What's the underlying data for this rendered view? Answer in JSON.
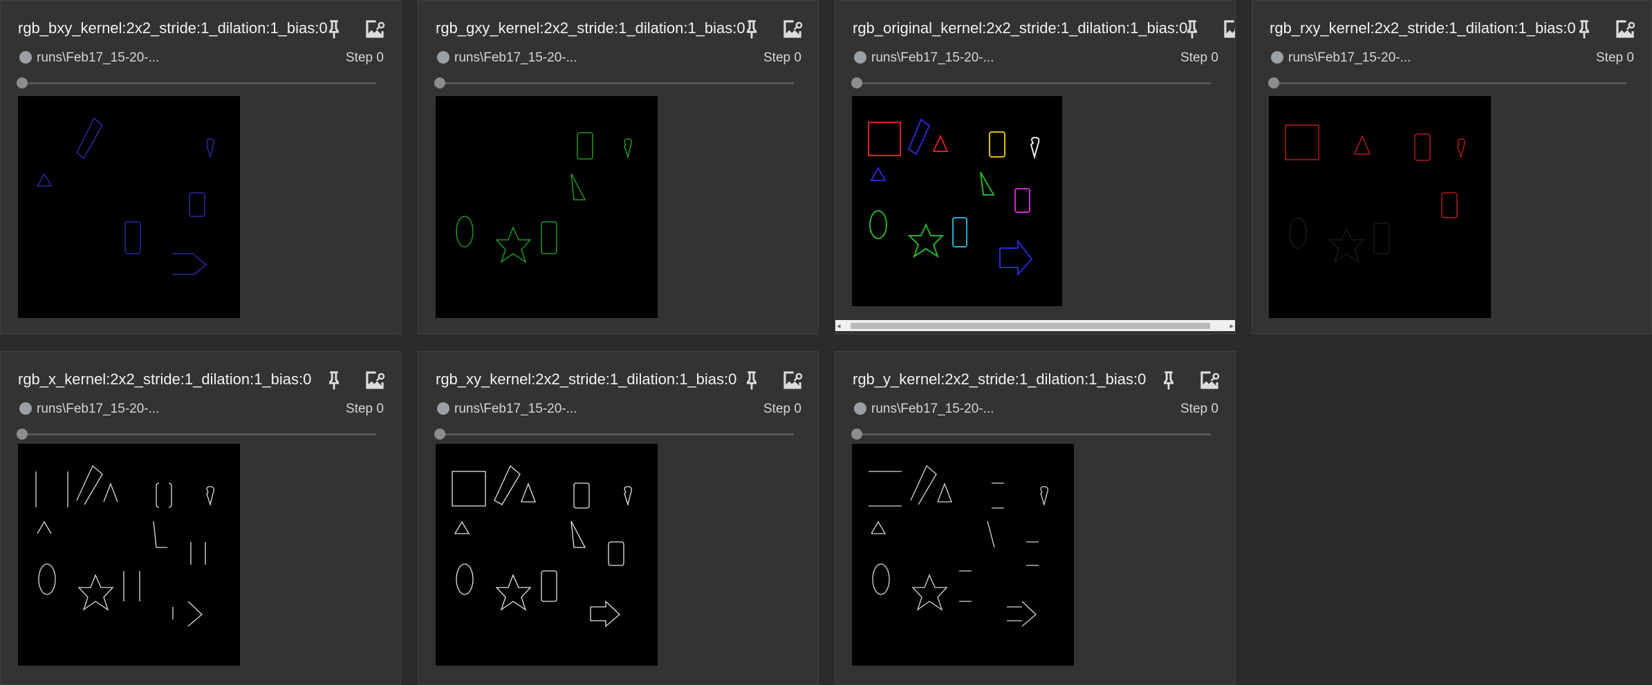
{
  "cards": [
    {
      "title": "rgb_bxy_kernel:2x2_stride:1_dilation:1_bias:0",
      "run": "runs\\Feb17_15-20-...",
      "step": "Step 0"
    },
    {
      "title": "rgb_gxy_kernel:2x2_stride:1_dilation:1_bias:0",
      "run": "runs\\Feb17_15-20-...",
      "step": "Step 0"
    },
    {
      "title": "rgb_original_kernel:2x2_stride:1_dilation:1_bias:0",
      "run": "runs\\Feb17_15-20-...",
      "step": "Step 0"
    },
    {
      "title": "rgb_rxy_kernel:2x2_stride:1_dilation:1_bias:0",
      "run": "runs\\Feb17_15-20-...",
      "step": "Step 0"
    },
    {
      "title": "rgb_x_kernel:2x2_stride:1_dilation:1_bias:0",
      "run": "runs\\Feb17_15-20-...",
      "step": "Step 0"
    },
    {
      "title": "rgb_xy_kernel:2x2_stride:1_dilation:1_bias:0",
      "run": "runs\\Feb17_15-20-...",
      "step": "Step 0"
    },
    {
      "title": "rgb_y_kernel:2x2_stride:1_dilation:1_bias:0",
      "run": "runs\\Feb17_15-20-...",
      "step": "Step 0"
    }
  ],
  "icons": {
    "pin": "pin-icon",
    "enlarge": "image-search-icon"
  },
  "colors": {
    "background": "#2b2b2b",
    "card": "#333333",
    "text": "#f2f2f2",
    "run_dot": "#9aa0a6"
  }
}
